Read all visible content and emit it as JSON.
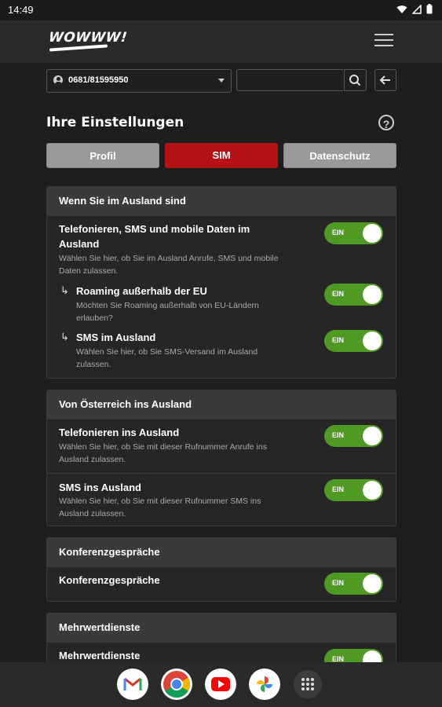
{
  "status_bar": {
    "time": "14:49"
  },
  "header": {
    "logo": "WOWWW!",
    "menu_icon": "hamburger-icon"
  },
  "top_controls": {
    "phone_number": "0681/81595950",
    "search_placeholder": "",
    "back_icon": "arrow-left-icon"
  },
  "page": {
    "title": "Ihre Einstellungen",
    "help_label": "?"
  },
  "tabs": [
    {
      "label": "Profil",
      "active": false
    },
    {
      "label": "SIM",
      "active": true
    },
    {
      "label": "Datenschutz",
      "active": false
    }
  ],
  "colors": {
    "active_tab": "#b51216",
    "toggle_on": "#4f9a23",
    "card_header": "#3a3a3a"
  },
  "sections": [
    {
      "header": "Wenn Sie im Ausland sind",
      "rows": [
        {
          "title": "Telefonieren, SMS und mobile Daten im Ausland",
          "desc": "Wählen Sie hier, ob Sie im Ausland Anrufe, SMS und mobile Daten zulassen.",
          "toggle": "EIN"
        },
        {
          "title": "Roaming außerhalb der EU",
          "desc": "Möchten Sie Roaming außerhalb von EU-Ländern erlauben?",
          "toggle": "EIN"
        },
        {
          "title": "SMS im Ausland",
          "desc": "Wählen Sie hier, ob Sie SMS-Versand im Ausland zulassen.",
          "toggle": "EIN"
        }
      ]
    },
    {
      "header": "Von Österreich ins Ausland",
      "rows": [
        {
          "title": "Telefonieren ins Ausland",
          "desc": "Wählen Sie hier, ob Sie mit dieser Rufnummer Anrufe ins Ausland zulassen.",
          "toggle": "EIN"
        },
        {
          "title": "SMS ins Ausland",
          "desc": "Wählen Sie hier, ob Sie mit dieser Rufnummer SMS ins Ausland zulassen.",
          "toggle": "EIN"
        }
      ]
    },
    {
      "header": "Konferenzgespräche",
      "rows": [
        {
          "title": "Konferenzgespräche",
          "desc": "",
          "toggle": "EIN"
        }
      ]
    },
    {
      "header": "Mehrwertdienste",
      "rows": [
        {
          "title": "Mehrwertdienste",
          "desc": "",
          "toggle": "EIN"
        }
      ]
    }
  ],
  "dock": [
    "gmail-icon",
    "chrome-icon",
    "youtube-icon",
    "photos-icon",
    "app-drawer-icon"
  ]
}
